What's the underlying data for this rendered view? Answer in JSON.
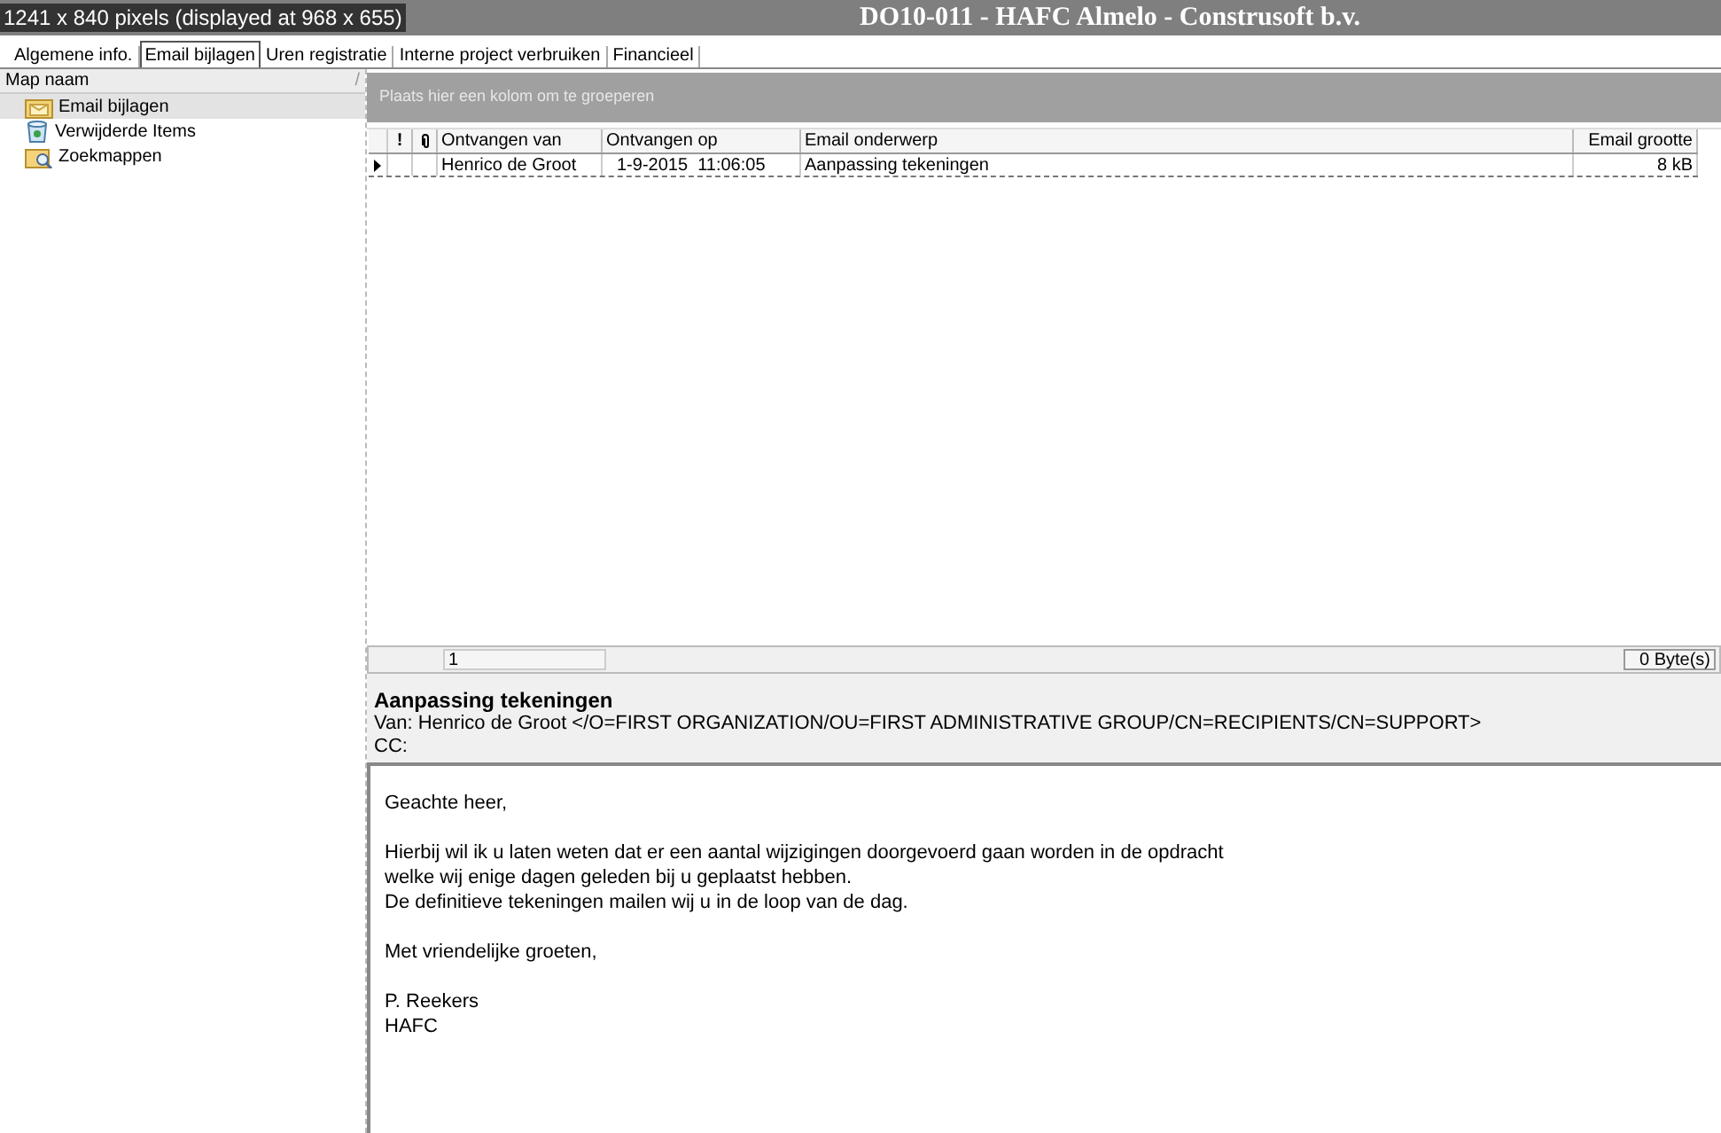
{
  "viewer_caption": "1241 x 840 pixels (displayed at 968 x 655)",
  "window": {
    "title": "DO10-011 - HAFC Almelo - Construsoft b.v."
  },
  "tabs": [
    {
      "label": "Algemene info.",
      "selected": false
    },
    {
      "label": "Email bijlagen",
      "selected": true
    },
    {
      "label": "Uren registratie",
      "selected": false
    },
    {
      "label": "Interne project verbruiken",
      "selected": false
    },
    {
      "label": "Financieel",
      "selected": false
    }
  ],
  "folder_panel": {
    "header": "Map naam",
    "sort_glyph": "/",
    "items": [
      {
        "label": "Email bijlagen",
        "kind": "inbox",
        "selected": true
      },
      {
        "label": "Verwijderde Items",
        "kind": "trash",
        "selected": false
      },
      {
        "label": "Zoekmappen",
        "kind": "search",
        "selected": false
      }
    ]
  },
  "group_area": {
    "placeholder": "Plaats hier een kolom om te groeperen"
  },
  "table": {
    "columns": [
      {
        "label": "!",
        "kind": "icon"
      },
      {
        "kind": "attach"
      },
      {
        "label": "Ontvangen van",
        "kind": "text"
      },
      {
        "label": "Ontvangen op",
        "kind": "text"
      },
      {
        "label": "Email onderwerp",
        "kind": "text"
      },
      {
        "label": "Email grootte",
        "kind": "size"
      }
    ],
    "rows": [
      {
        "selected": true,
        "cells": [
          "",
          "",
          "Henrico de Groot",
          "1-9-2015  11:06:05",
          "Aanpassing tekeningen",
          "8 kB"
        ]
      }
    ],
    "footer": {
      "count": "1",
      "size": "0 Byte(s)"
    }
  },
  "preview": {
    "subject": "Aanpassing tekeningen",
    "from": "Van: Henrico de Groot </O=FIRST ORGANIZATION/OU=FIRST ADMINISTRATIVE GROUP/CN=RECIPIENTS/CN=SUPPORT>",
    "cc": "CC:",
    "paragraphs": [
      [
        "Geachte heer,"
      ],
      [
        "Hierbij wil ik u laten weten dat er een aantal wijzigingen doorgevoerd gaan worden in de opdracht",
        "welke wij enige dagen geleden bij u geplaatst hebben.",
        "De definitieve tekeningen mailen wij u in de loop van de dag."
      ],
      [
        "Met vriendelijke groeten,"
      ],
      [
        "P. Reekers",
        "HAFC"
      ]
    ]
  }
}
